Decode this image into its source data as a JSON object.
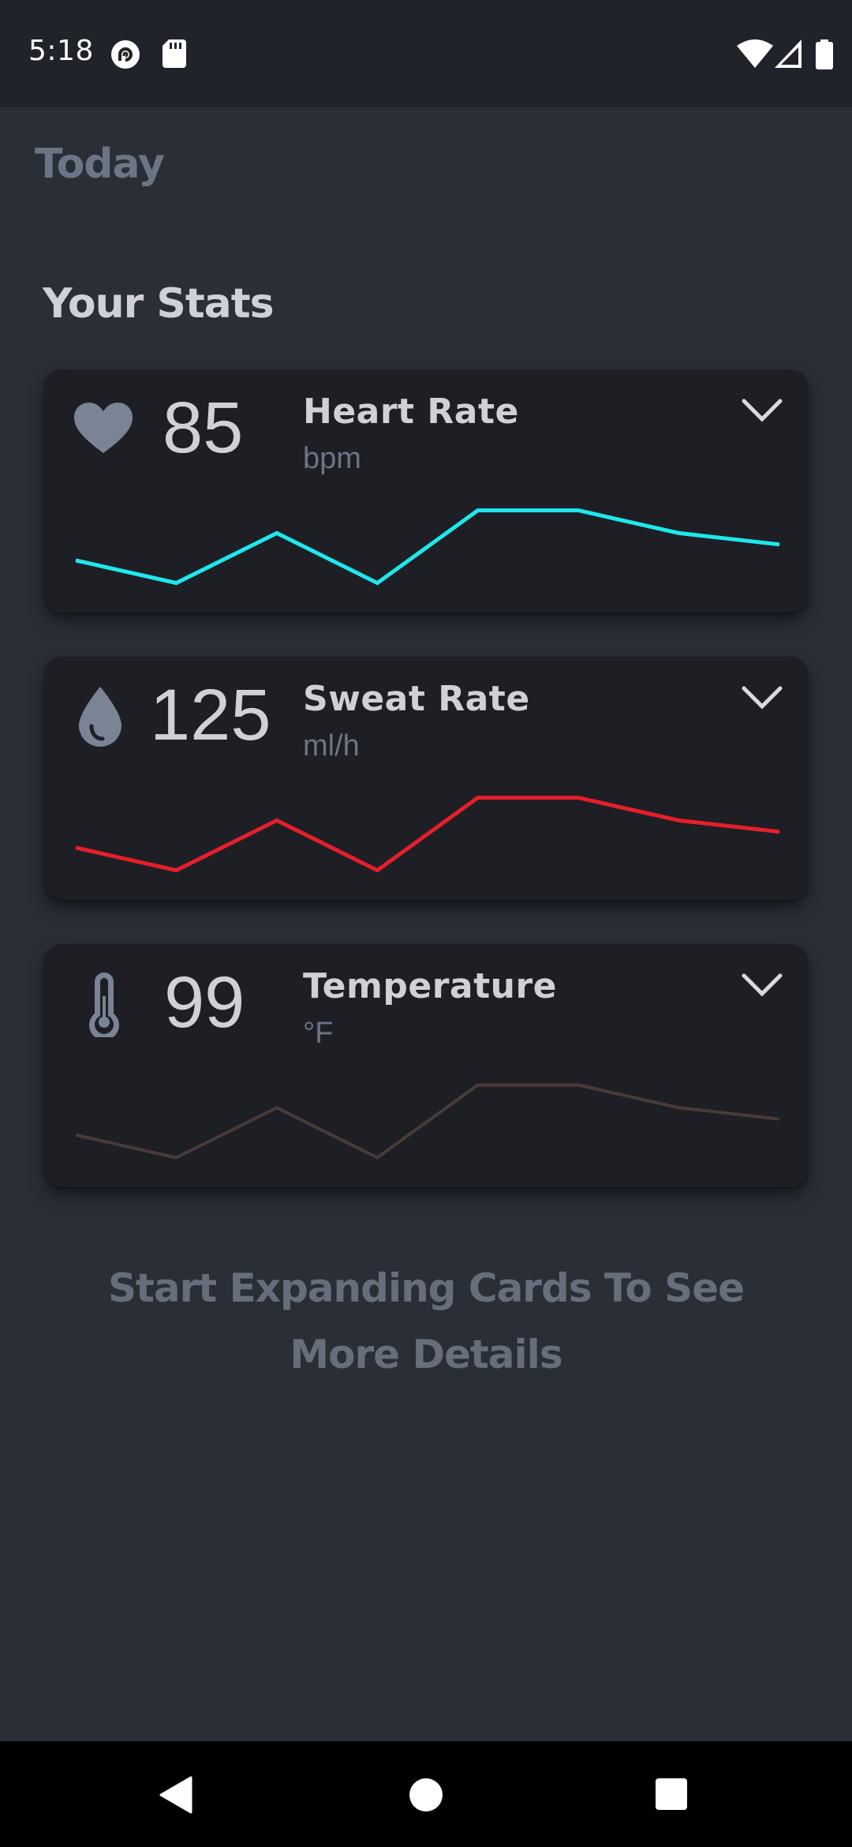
{
  "status_bar": {
    "time": "5:18",
    "icons": [
      "pocket-casts-icon",
      "sd-card-icon",
      "wifi-icon",
      "cell-signal-icon",
      "battery-icon"
    ]
  },
  "page": {
    "title": "Today",
    "section_title": "Your Stats",
    "hint": "Start Expanding Cards To See More Details"
  },
  "cards": [
    {
      "icon": "heart-icon",
      "value": "85",
      "label": "Heart Rate",
      "unit": "bpm",
      "line_color": "#1ee8ec",
      "trend": [
        40,
        30,
        52,
        30,
        62,
        62,
        52,
        47
      ]
    },
    {
      "icon": "water-drop-icon",
      "value": "125",
      "label": "Sweat Rate",
      "unit": "ml/h",
      "line_color": "#e61f2a",
      "trend": [
        40,
        30,
        52,
        30,
        62,
        62,
        52,
        47
      ]
    },
    {
      "icon": "thermometer-icon",
      "value": "99",
      "label": "Temperature",
      "unit": "°F",
      "line_color": "#4a3a3a",
      "trend": [
        40,
        30,
        52,
        30,
        62,
        62,
        52,
        47
      ]
    }
  ],
  "colors": {
    "background": "#2a2e37",
    "card": "#1d1f25",
    "status_bar": "#21232b",
    "muted_text": "#6c7585",
    "primary_text": "#cfd1d6"
  },
  "nav_bar": {
    "icons": [
      "back-icon",
      "home-icon",
      "recents-icon"
    ]
  }
}
